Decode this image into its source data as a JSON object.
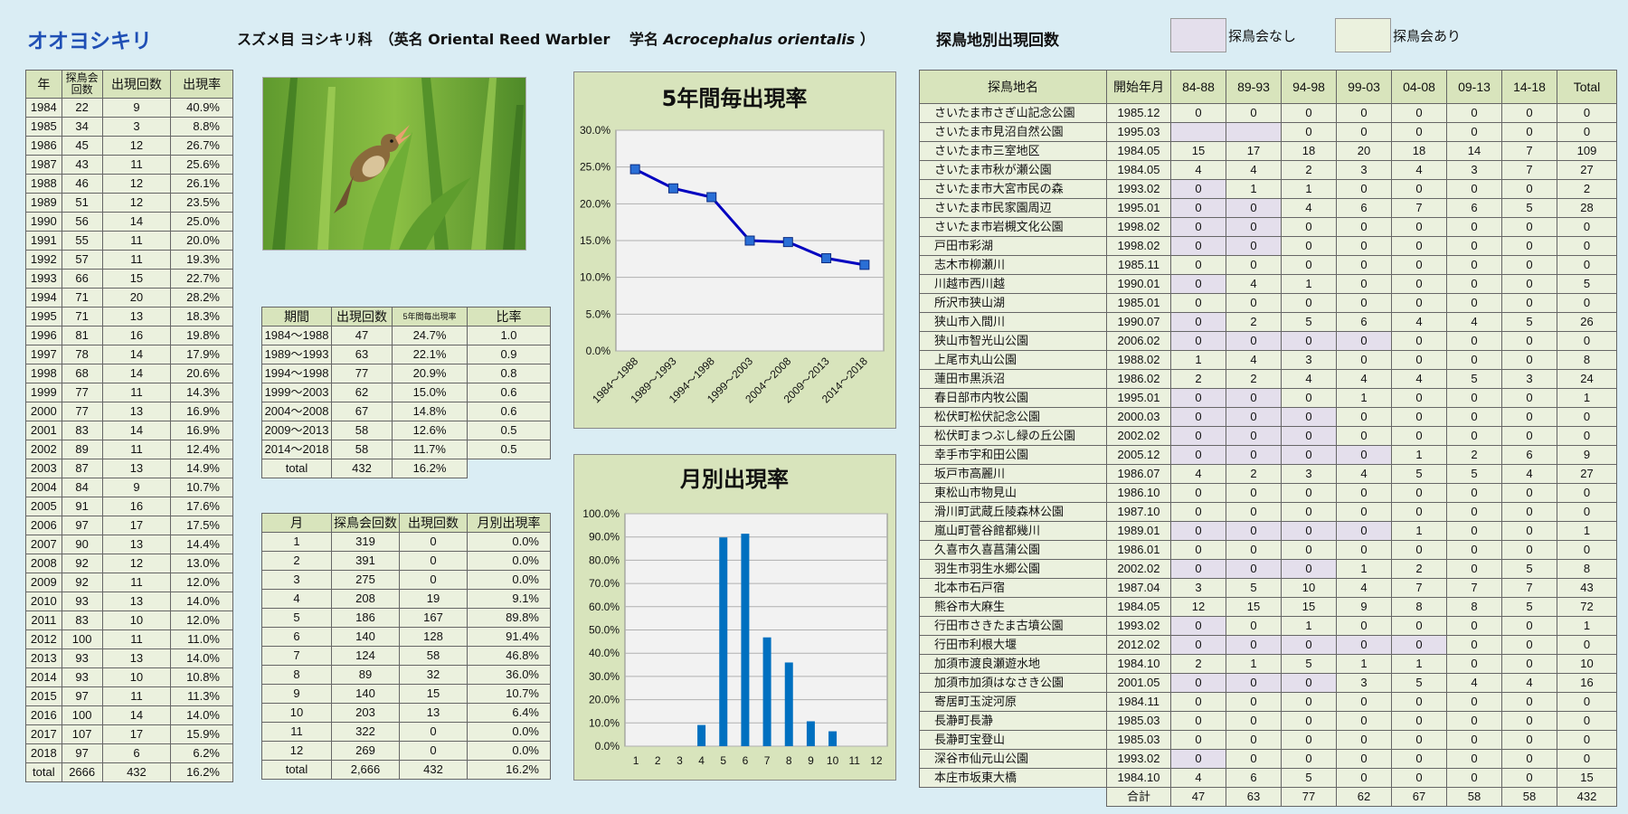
{
  "header": {
    "species": "オオヨシキリ",
    "taxonomy_pre": "スズメ目 ヨシキリ科　（英名 Oriental Reed Warbler　 学名 ",
    "sci_name": "Acrocephalus orientalis",
    "taxonomy_post": " ）",
    "site_title": "探鳥地別出現回数",
    "legend_no": "探鳥会なし",
    "legend_yes": "探鳥会あり",
    "legend_colors": {
      "no": "#e4dfec",
      "yes": "#ebf1de"
    }
  },
  "yearly": {
    "headers": [
      "年",
      "探鳥会回数",
      "出現回数",
      "出現率"
    ],
    "rows": [
      [
        "1984",
        "22",
        "9",
        "40.9%"
      ],
      [
        "1985",
        "34",
        "3",
        "8.8%"
      ],
      [
        "1986",
        "45",
        "12",
        "26.7%"
      ],
      [
        "1987",
        "43",
        "11",
        "25.6%"
      ],
      [
        "1988",
        "46",
        "12",
        "26.1%"
      ],
      [
        "1989",
        "51",
        "12",
        "23.5%"
      ],
      [
        "1990",
        "56",
        "14",
        "25.0%"
      ],
      [
        "1991",
        "55",
        "11",
        "20.0%"
      ],
      [
        "1992",
        "57",
        "11",
        "19.3%"
      ],
      [
        "1993",
        "66",
        "15",
        "22.7%"
      ],
      [
        "1994",
        "71",
        "20",
        "28.2%"
      ],
      [
        "1995",
        "71",
        "13",
        "18.3%"
      ],
      [
        "1996",
        "81",
        "16",
        "19.8%"
      ],
      [
        "1997",
        "78",
        "14",
        "17.9%"
      ],
      [
        "1998",
        "68",
        "14",
        "20.6%"
      ],
      [
        "1999",
        "77",
        "11",
        "14.3%"
      ],
      [
        "2000",
        "77",
        "13",
        "16.9%"
      ],
      [
        "2001",
        "83",
        "14",
        "16.9%"
      ],
      [
        "2002",
        "89",
        "11",
        "12.4%"
      ],
      [
        "2003",
        "87",
        "13",
        "14.9%"
      ],
      [
        "2004",
        "84",
        "9",
        "10.7%"
      ],
      [
        "2005",
        "91",
        "16",
        "17.6%"
      ],
      [
        "2006",
        "97",
        "17",
        "17.5%"
      ],
      [
        "2007",
        "90",
        "13",
        "14.4%"
      ],
      [
        "2008",
        "92",
        "12",
        "13.0%"
      ],
      [
        "2009",
        "92",
        "11",
        "12.0%"
      ],
      [
        "2010",
        "93",
        "13",
        "14.0%"
      ],
      [
        "2011",
        "83",
        "10",
        "12.0%"
      ],
      [
        "2012",
        "100",
        "11",
        "11.0%"
      ],
      [
        "2013",
        "93",
        "13",
        "14.0%"
      ],
      [
        "2014",
        "93",
        "10",
        "10.8%"
      ],
      [
        "2015",
        "97",
        "11",
        "11.3%"
      ],
      [
        "2016",
        "100",
        "14",
        "14.0%"
      ],
      [
        "2017",
        "107",
        "17",
        "15.9%"
      ],
      [
        "2018",
        "97",
        "6",
        "6.2%"
      ],
      [
        "total",
        "2666",
        "432",
        "16.2%"
      ]
    ]
  },
  "period": {
    "headers": [
      "期間",
      "出現回数",
      "5年間毎出現率",
      "比率"
    ],
    "rows": [
      [
        "1984～1988",
        "47",
        "24.7%",
        "1.0"
      ],
      [
        "1989～1993",
        "63",
        "22.1%",
        "0.9"
      ],
      [
        "1994～1998",
        "77",
        "20.9%",
        "0.8"
      ],
      [
        "1999～2003",
        "62",
        "15.0%",
        "0.6"
      ],
      [
        "2004～2008",
        "67",
        "14.8%",
        "0.6"
      ],
      [
        "2009～2013",
        "58",
        "12.6%",
        "0.5"
      ],
      [
        "2014～2018",
        "58",
        "11.7%",
        "0.5"
      ]
    ],
    "total": [
      "total",
      "432",
      "16.2%"
    ]
  },
  "monthly": {
    "headers": [
      "月",
      "探鳥会回数",
      "出現回数",
      "月別出現率"
    ],
    "rows": [
      [
        "1",
        "319",
        "0",
        "0.0%"
      ],
      [
        "2",
        "391",
        "0",
        "0.0%"
      ],
      [
        "3",
        "275",
        "0",
        "0.0%"
      ],
      [
        "4",
        "208",
        "19",
        "9.1%"
      ],
      [
        "5",
        "186",
        "167",
        "89.8%"
      ],
      [
        "6",
        "140",
        "128",
        "91.4%"
      ],
      [
        "7",
        "124",
        "58",
        "46.8%"
      ],
      [
        "8",
        "89",
        "32",
        "36.0%"
      ],
      [
        "9",
        "140",
        "15",
        "10.7%"
      ],
      [
        "10",
        "203",
        "13",
        "6.4%"
      ],
      [
        "11",
        "322",
        "0",
        "0.0%"
      ],
      [
        "12",
        "269",
        "0",
        "0.0%"
      ],
      [
        "total",
        "2,666",
        "432",
        "16.2%"
      ]
    ]
  },
  "sites": {
    "headers": [
      "探鳥地名",
      "開始年月",
      "84-88",
      "89-93",
      "94-98",
      "99-03",
      "04-08",
      "09-13",
      "14-18",
      "Total"
    ],
    "rows": [
      {
        "name": "さいたま市さぎ山記念公園",
        "start": "1985.12",
        "v": [
          "0",
          "0",
          "0",
          "0",
          "0",
          "0",
          "0",
          "0"
        ],
        "p": []
      },
      {
        "name": "さいたま市見沼自然公園",
        "start": "1995.03",
        "v": [
          "",
          "",
          "0",
          "0",
          "0",
          "0",
          "0",
          "0"
        ],
        "p": [
          0,
          1
        ]
      },
      {
        "name": "さいたま市三室地区",
        "start": "1984.05",
        "v": [
          "15",
          "17",
          "18",
          "20",
          "18",
          "14",
          "7",
          "109"
        ],
        "p": []
      },
      {
        "name": "さいたま市秋が瀬公園",
        "start": "1984.05",
        "v": [
          "4",
          "4",
          "2",
          "3",
          "4",
          "3",
          "7",
          "27"
        ],
        "p": []
      },
      {
        "name": "さいたま市大宮市民の森",
        "start": "1993.02",
        "v": [
          "0",
          "1",
          "1",
          "0",
          "0",
          "0",
          "0",
          "2"
        ],
        "p": [
          0
        ]
      },
      {
        "name": "さいたま市民家園周辺",
        "start": "1995.01",
        "v": [
          "0",
          "0",
          "4",
          "6",
          "7",
          "6",
          "5",
          "28"
        ],
        "p": [
          0,
          1
        ]
      },
      {
        "name": "さいたま市岩槻文化公園",
        "start": "1998.02",
        "v": [
          "0",
          "0",
          "0",
          "0",
          "0",
          "0",
          "0",
          "0"
        ],
        "p": [
          0,
          1
        ]
      },
      {
        "name": "戸田市彩湖",
        "start": "1998.02",
        "v": [
          "0",
          "0",
          "0",
          "0",
          "0",
          "0",
          "0",
          "0"
        ],
        "p": [
          0,
          1
        ]
      },
      {
        "name": "志木市柳瀬川",
        "start": "1985.11",
        "v": [
          "0",
          "0",
          "0",
          "0",
          "0",
          "0",
          "0",
          "0"
        ],
        "p": []
      },
      {
        "name": "川越市西川越",
        "start": "1990.01",
        "v": [
          "0",
          "4",
          "1",
          "0",
          "0",
          "0",
          "0",
          "5"
        ],
        "p": [
          0
        ]
      },
      {
        "name": "所沢市狭山湖",
        "start": "1985.01",
        "v": [
          "0",
          "0",
          "0",
          "0",
          "0",
          "0",
          "0",
          "0"
        ],
        "p": []
      },
      {
        "name": "狭山市入間川",
        "start": "1990.07",
        "v": [
          "0",
          "2",
          "5",
          "6",
          "4",
          "4",
          "5",
          "26"
        ],
        "p": [
          0
        ]
      },
      {
        "name": "狭山市智光山公園",
        "start": "2006.02",
        "v": [
          "0",
          "0",
          "0",
          "0",
          "0",
          "0",
          "0",
          "0"
        ],
        "p": [
          0,
          1,
          2,
          3
        ]
      },
      {
        "name": "上尾市丸山公園",
        "start": "1988.02",
        "v": [
          "1",
          "4",
          "3",
          "0",
          "0",
          "0",
          "0",
          "8"
        ],
        "p": []
      },
      {
        "name": "蓮田市黒浜沼",
        "start": "1986.02",
        "v": [
          "2",
          "2",
          "4",
          "4",
          "4",
          "5",
          "3",
          "24"
        ],
        "p": []
      },
      {
        "name": "春日部市内牧公園",
        "start": "1995.01",
        "v": [
          "0",
          "0",
          "0",
          "1",
          "0",
          "0",
          "0",
          "1"
        ],
        "p": [
          0,
          1
        ]
      },
      {
        "name": "松伏町松伏記念公園",
        "start": "2000.03",
        "v": [
          "0",
          "0",
          "0",
          "0",
          "0",
          "0",
          "0",
          "0"
        ],
        "p": [
          0,
          1,
          2
        ]
      },
      {
        "name": "松伏町まつぶし緑の丘公園",
        "start": "2002.02",
        "v": [
          "0",
          "0",
          "0",
          "0",
          "0",
          "0",
          "0",
          "0"
        ],
        "p": [
          0,
          1,
          2
        ]
      },
      {
        "name": "幸手市宇和田公園",
        "start": "2005.12",
        "v": [
          "0",
          "0",
          "0",
          "0",
          "1",
          "2",
          "6",
          "9"
        ],
        "p": [
          0,
          1,
          2,
          3
        ]
      },
      {
        "name": "坂戸市高麗川",
        "start": "1986.07",
        "v": [
          "4",
          "2",
          "3",
          "4",
          "5",
          "5",
          "4",
          "27"
        ],
        "p": []
      },
      {
        "name": "東松山市物見山",
        "start": "1986.10",
        "v": [
          "0",
          "0",
          "0",
          "0",
          "0",
          "0",
          "0",
          "0"
        ],
        "p": []
      },
      {
        "name": "滑川町武蔵丘陵森林公園",
        "start": "1987.10",
        "v": [
          "0",
          "0",
          "0",
          "0",
          "0",
          "0",
          "0",
          "0"
        ],
        "p": []
      },
      {
        "name": "嵐山町菅谷館都幾川",
        "start": "1989.01",
        "v": [
          "0",
          "0",
          "0",
          "0",
          "1",
          "0",
          "0",
          "1"
        ],
        "p": [
          0,
          1,
          2,
          3
        ]
      },
      {
        "name": "久喜市久喜菖蒲公園",
        "start": "1986.01",
        "v": [
          "0",
          "0",
          "0",
          "0",
          "0",
          "0",
          "0",
          "0"
        ],
        "p": []
      },
      {
        "name": "羽生市羽生水郷公園",
        "start": "2002.02",
        "v": [
          "0",
          "0",
          "0",
          "1",
          "2",
          "0",
          "5",
          "8"
        ],
        "p": [
          0,
          1,
          2
        ]
      },
      {
        "name": "北本市石戸宿",
        "start": "1987.04",
        "v": [
          "3",
          "5",
          "10",
          "4",
          "7",
          "7",
          "7",
          "43"
        ],
        "p": []
      },
      {
        "name": "熊谷市大麻生",
        "start": "1984.05",
        "v": [
          "12",
          "15",
          "15",
          "9",
          "8",
          "8",
          "5",
          "72"
        ],
        "p": []
      },
      {
        "name": "行田市さきたま古墳公園",
        "start": "1993.02",
        "v": [
          "0",
          "0",
          "1",
          "0",
          "0",
          "0",
          "0",
          "1"
        ],
        "p": [
          0
        ]
      },
      {
        "name": "行田市利根大堰",
        "start": "2012.02",
        "v": [
          "0",
          "0",
          "0",
          "0",
          "0",
          "0",
          "0",
          "0"
        ],
        "p": [
          0,
          1,
          2,
          3,
          4
        ]
      },
      {
        "name": "加須市渡良瀬遊水地",
        "start": "1984.10",
        "v": [
          "2",
          "1",
          "5",
          "1",
          "1",
          "0",
          "0",
          "10"
        ],
        "p": []
      },
      {
        "name": "加須市加須はなさき公園",
        "start": "2001.05",
        "v": [
          "0",
          "0",
          "0",
          "3",
          "5",
          "4",
          "4",
          "16"
        ],
        "p": [
          0,
          1,
          2
        ]
      },
      {
        "name": "寄居町玉淀河原",
        "start": "1984.11",
        "v": [
          "0",
          "0",
          "0",
          "0",
          "0",
          "0",
          "0",
          "0"
        ],
        "p": []
      },
      {
        "name": "長瀞町長瀞",
        "start": "1985.03",
        "v": [
          "0",
          "0",
          "0",
          "0",
          "0",
          "0",
          "0",
          "0"
        ],
        "p": []
      },
      {
        "name": "長瀞町宝登山",
        "start": "1985.03",
        "v": [
          "0",
          "0",
          "0",
          "0",
          "0",
          "0",
          "0",
          "0"
        ],
        "p": []
      },
      {
        "name": "深谷市仙元山公園",
        "start": "1993.02",
        "v": [
          "0",
          "0",
          "0",
          "0",
          "0",
          "0",
          "0",
          "0"
        ],
        "p": [
          0
        ]
      },
      {
        "name": "本庄市坂東大橋",
        "start": "1984.10",
        "v": [
          "4",
          "6",
          "5",
          "0",
          "0",
          "0",
          "0",
          "15"
        ],
        "p": []
      }
    ],
    "total_label": "合計",
    "totals": [
      "47",
      "63",
      "77",
      "62",
      "67",
      "58",
      "58",
      "432"
    ]
  },
  "chart_data": [
    {
      "type": "line",
      "title": "5年間毎出現率",
      "categories": [
        "1984～1988",
        "1989～1993",
        "1994～1998",
        "1999～2003",
        "2004～2008",
        "2009～2013",
        "2014～2018"
      ],
      "values": [
        24.7,
        22.1,
        20.9,
        15.0,
        14.8,
        12.6,
        11.7
      ],
      "ylim": [
        0,
        30
      ],
      "yticks": [
        "0.0%",
        "5.0%",
        "10.0%",
        "15.0%",
        "20.0%",
        "25.0%",
        "30.0%"
      ],
      "color": "#0000c0",
      "grid": true
    },
    {
      "type": "bar",
      "title": "月別出現率",
      "categories": [
        "1",
        "2",
        "3",
        "4",
        "5",
        "6",
        "7",
        "8",
        "9",
        "10",
        "11",
        "12"
      ],
      "values": [
        0,
        0,
        0,
        9.1,
        89.8,
        91.4,
        46.8,
        36.0,
        10.7,
        6.4,
        0,
        0
      ],
      "ylim": [
        0,
        100
      ],
      "yticks": [
        "0.0%",
        "10.0%",
        "20.0%",
        "30.0%",
        "40.0%",
        "50.0%",
        "60.0%",
        "70.0%",
        "80.0%",
        "90.0%",
        "100.0%"
      ],
      "color": "#0070c0",
      "grid": true
    }
  ]
}
